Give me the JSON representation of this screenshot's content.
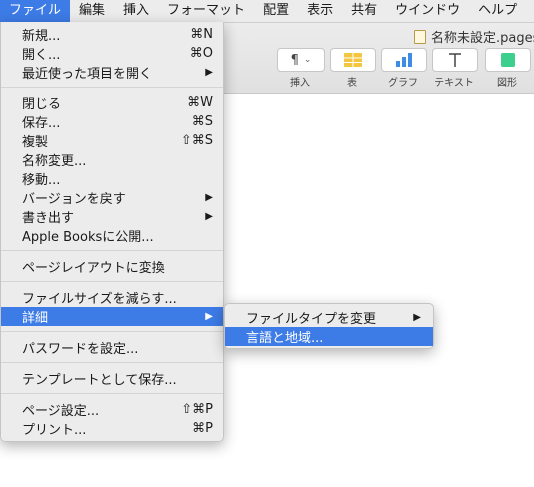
{
  "menubar": {
    "items": [
      "ファイル",
      "編集",
      "挿入",
      "フォーマット",
      "配置",
      "表示",
      "共有",
      "ウインドウ",
      "ヘルプ"
    ]
  },
  "window": {
    "doc_title": "名称未設定.pages",
    "toolbar": {
      "insert_label": "挿入",
      "table_label": "表",
      "chart_label": "グラフ",
      "text_label": "テキスト",
      "shape_label": "図形",
      "insert_glyph": "¶"
    }
  },
  "file_menu": {
    "items": [
      {
        "label": "新規...",
        "shortcut": "⌘N"
      },
      {
        "label": "開く...",
        "shortcut": "⌘O"
      },
      {
        "label": "最近使った項目を開く",
        "shortcut": "▶"
      },
      {
        "label": "閉じる",
        "shortcut": "⌘W"
      },
      {
        "label": "保存...",
        "shortcut": "⌘S"
      },
      {
        "label": "複製",
        "shortcut": "⇧⌘S"
      },
      {
        "label": "名称変更...",
        "shortcut": ""
      },
      {
        "label": "移動...",
        "shortcut": ""
      },
      {
        "label": "バージョンを戻す",
        "shortcut": "▶"
      },
      {
        "label": "書き出す",
        "shortcut": "▶"
      },
      {
        "label": "Apple Booksに公開...",
        "shortcut": ""
      },
      {
        "label": "ページレイアウトに変換",
        "shortcut": ""
      },
      {
        "label": "ファイルサイズを減らす...",
        "shortcut": ""
      },
      {
        "label": "詳細",
        "shortcut": "▶"
      },
      {
        "label": "パスワードを設定...",
        "shortcut": ""
      },
      {
        "label": "テンプレートとして保存...",
        "shortcut": ""
      },
      {
        "label": "ページ設定...",
        "shortcut": "⇧⌘P"
      },
      {
        "label": "プリント...",
        "shortcut": "⌘P"
      }
    ]
  },
  "advanced_submenu": {
    "items": [
      {
        "label": "ファイルタイプを変更",
        "shortcut": "▶"
      },
      {
        "label": "言語と地域...",
        "shortcut": ""
      }
    ]
  },
  "colors": {
    "highlight": "#3d7be6"
  }
}
